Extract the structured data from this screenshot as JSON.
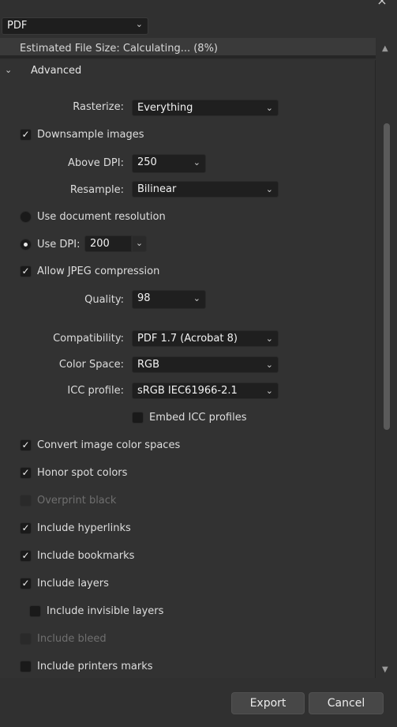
{
  "window": {
    "close_glyph": "×"
  },
  "format": {
    "value": "PDF"
  },
  "file_size": {
    "text": "Estimated File Size: Calculating... (8%)"
  },
  "advanced": {
    "title": "Advanced",
    "rasterize": {
      "label": "Rasterize:",
      "value": "Everything"
    },
    "downsample": {
      "label": "Downsample images",
      "checked": true
    },
    "above_dpi": {
      "label": "Above DPI:",
      "value": "250"
    },
    "resample": {
      "label": "Resample:",
      "value": "Bilinear"
    },
    "use_document_resolution": {
      "label": "Use document resolution",
      "selected": false
    },
    "use_dpi": {
      "label": "Use DPI:",
      "value": "200",
      "selected": true
    },
    "jpeg": {
      "label": "Allow JPEG compression",
      "checked": true
    },
    "quality": {
      "label": "Quality:",
      "value": "98"
    },
    "compatibility": {
      "label": "Compatibility:",
      "value": "PDF 1.7 (Acrobat 8)"
    },
    "color_space": {
      "label": "Color Space:",
      "value": "RGB"
    },
    "icc_profile": {
      "label": "ICC profile:",
      "value": "sRGB IEC61966-2.1"
    },
    "embed_icc": {
      "label": "Embed ICC profiles",
      "checked": false
    },
    "options": [
      {
        "label": "Convert image color spaces",
        "checked": true,
        "enabled": true
      },
      {
        "label": "Honor spot colors",
        "checked": true,
        "enabled": true
      },
      {
        "label": "Overprint black",
        "checked": false,
        "enabled": false
      },
      {
        "label": "Include hyperlinks",
        "checked": true,
        "enabled": true
      },
      {
        "label": "Include bookmarks",
        "checked": true,
        "enabled": true
      },
      {
        "label": "Include layers",
        "checked": true,
        "enabled": true
      },
      {
        "label": "Include invisible layers",
        "checked": false,
        "enabled": true
      },
      {
        "label": "Include bleed",
        "checked": false,
        "enabled": false
      },
      {
        "label": "Include printers marks",
        "checked": false,
        "enabled": true
      }
    ]
  },
  "footer": {
    "export_label": "Export",
    "cancel_label": "Cancel"
  },
  "icons": {
    "chevron": "⌄",
    "check": "✓",
    "scroll_up": "▲",
    "scroll_down": "▼",
    "caret": "⌄"
  }
}
